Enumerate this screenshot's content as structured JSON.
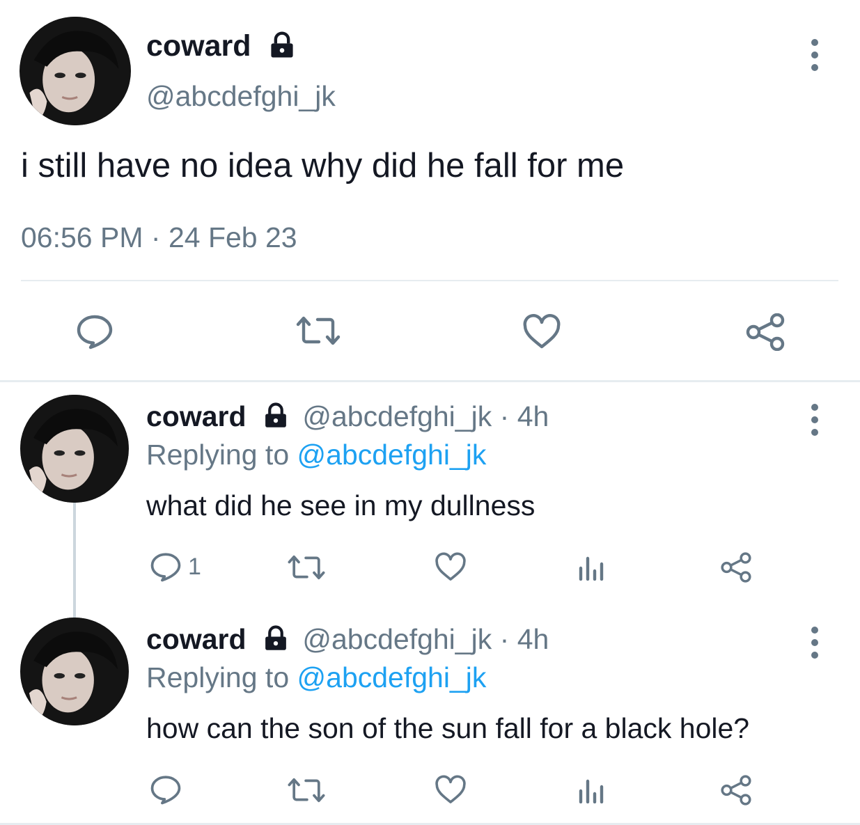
{
  "main_tweet": {
    "display_name": "coward",
    "handle": "@abcdefghi_jk",
    "text": "i still have no idea why did he fall for me",
    "time": "06:56 PM",
    "separator": "·",
    "date": "24 Feb 23",
    "icons": [
      "more-vertical-icon",
      "lock-icon",
      "reply-icon",
      "retweet-icon",
      "like-icon",
      "share-icon"
    ]
  },
  "replies": [
    {
      "display_name": "coward",
      "handle": "@abcdefghi_jk",
      "dot": "·",
      "age": "4h",
      "replying_prefix": "Replying to",
      "replying_handle": "@abcdefghi_jk",
      "text": "what did he see in my dullness",
      "reply_count": "1"
    },
    {
      "display_name": "coward",
      "handle": "@abcdefghi_jk",
      "dot": "·",
      "age": "4h",
      "replying_prefix": "Replying to",
      "replying_handle": "@abcdefghi_jk",
      "text": "how can the son of the sun fall for a black hole?",
      "reply_count": ""
    }
  ],
  "colors": {
    "text": "#141823",
    "muted": "#657786",
    "link": "#1DA1F2",
    "divider": "#e6ecf0"
  }
}
